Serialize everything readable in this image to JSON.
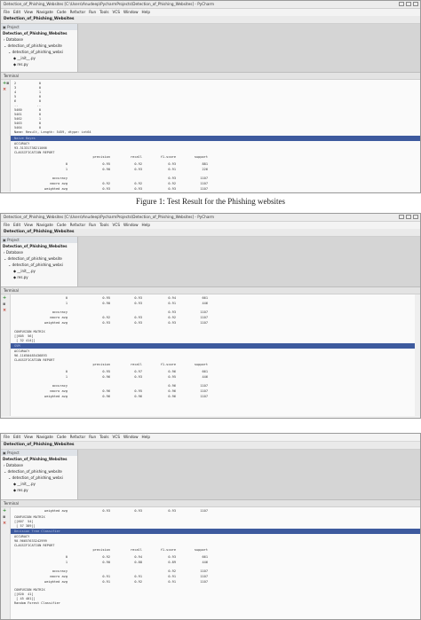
{
  "caption": "Figure 1: Test Result for the Phishing websites",
  "window_title": "Detection_of_Phishing_Websites [C:\\Users\\Anudeep\\PycharmProjects\\Detection_of_Phishing_Websites] - PyCharm",
  "menu": [
    "File",
    "Edit",
    "View",
    "Navigate",
    "Code",
    "Refactor",
    "Run",
    "Tools",
    "VCS",
    "Window",
    "Help"
  ],
  "breadcrumb": "Detection_of_Phishing_Websites",
  "project_tab": "Project",
  "tree": {
    "root": "Detection_of_Phishing_Websites",
    "items": [
      "Database",
      "detection_of_phishing_website",
      "detection_of_phishing_websi",
      "__init__.py",
      "res.py"
    ]
  },
  "terminal_label": "Terminal",
  "report_headers": {
    "precision": "precision",
    "recall": "recall",
    "f1": "f1-score",
    "support": "support"
  },
  "shot1": {
    "top_rows": [
      {
        "idx": "2",
        "val": "0"
      },
      {
        "idx": "3",
        "val": "0"
      },
      {
        "idx": "4",
        "val": "1"
      },
      {
        "idx": "5",
        "val": "0"
      },
      {
        "idx": "6",
        "val": "0"
      },
      {
        "idx": "..",
        "val": ".."
      },
      {
        "idx": "5460",
        "val": "0"
      },
      {
        "idx": "5461",
        "val": "0"
      },
      {
        "idx": "5462",
        "val": "1"
      },
      {
        "idx": "5463",
        "val": "0"
      },
      {
        "idx": "5464",
        "val": "0"
      }
    ],
    "series_info": "Name: Result, Length: 5459, dtype: int64",
    "highlight": "Naive Bayes",
    "accuracy_label": "ACCURACY",
    "accuracy_value": "93.31331738211066",
    "report_title": "CLASSIFICATION REPORT",
    "rows": [
      {
        "label": "0",
        "p": "0.95",
        "r": "0.92",
        "f": "0.93",
        "s": "881"
      },
      {
        "label": "1",
        "p": "0.90",
        "r": "0.93",
        "f": "0.91",
        "s": "226"
      },
      {
        "label": "accuracy",
        "p": "",
        "r": "",
        "f": "0.93",
        "s": "1107"
      },
      {
        "label": "macro avg",
        "p": "0.92",
        "r": "0.92",
        "f": "0.92",
        "s": "1107"
      },
      {
        "label": "weighted avg",
        "p": "0.93",
        "r": "0.93",
        "f": "0.93",
        "s": "1107"
      }
    ]
  },
  "shot2": {
    "top_rows": [
      {
        "label": "0",
        "p": "0.95",
        "r": "0.93",
        "f": "0.94",
        "s": "661"
      },
      {
        "label": "1",
        "p": "0.90",
        "r": "0.93",
        "f": "0.91",
        "s": "446"
      },
      {
        "label": "accuracy",
        "p": "",
        "r": "",
        "f": "0.93",
        "s": "1107"
      },
      {
        "label": "macro avg",
        "p": "0.92",
        "r": "0.93",
        "f": "0.92",
        "s": "1107"
      },
      {
        "label": "weighted avg",
        "p": "0.93",
        "r": "0.93",
        "f": "0.93",
        "s": "1107"
      }
    ],
    "matrix_title": "CONFUSION MATRIX",
    "matrix": [
      "[[605  56]",
      " [ 32 414]]"
    ],
    "highlight": "SVM",
    "accuracy_label": "ACCURACY",
    "accuracy_value": "96.11650485436893",
    "report_title": "CLASSIFICATION REPORT",
    "rows": [
      {
        "label": "0",
        "p": "0.95",
        "r": "0.97",
        "f": "0.96",
        "s": "661"
      },
      {
        "label": "1",
        "p": "0.96",
        "r": "0.93",
        "f": "0.95",
        "s": "446"
      },
      {
        "label": "accuracy",
        "p": "",
        "r": "",
        "f": "0.96",
        "s": "1107"
      },
      {
        "label": "macro avg",
        "p": "0.96",
        "r": "0.95",
        "f": "0.96",
        "s": "1107"
      },
      {
        "label": "weighted avg",
        "p": "0.96",
        "r": "0.96",
        "f": "0.96",
        "s": "1107"
      }
    ]
  },
  "shot3": {
    "first_line": {
      "label": "weighted avg",
      "p": "0.93",
      "r": "0.93",
      "f": "0.93",
      "s": "1107"
    },
    "matrix_title": "CONFUSION MATRIX",
    "matrix": [
      "[[607  54]",
      " [ 57 389]]"
    ],
    "highlight": "Decision Tree Classifier",
    "accuracy_label": "ACCURACY",
    "accuracy_value": "90.96657633242999",
    "report_title": "CLASSIFICATION REPORT",
    "rows": [
      {
        "label": "0",
        "p": "0.92",
        "r": "0.94",
        "f": "0.93",
        "s": "661"
      },
      {
        "label": "1",
        "p": "0.90",
        "r": "0.88",
        "f": "0.89",
        "s": "446"
      },
      {
        "label": "accuracy",
        "p": "",
        "r": "",
        "f": "0.92",
        "s": "1107"
      },
      {
        "label": "macro avg",
        "p": "0.91",
        "r": "0.91",
        "f": "0.91",
        "s": "1107"
      },
      {
        "label": "weighted avg",
        "p": "0.91",
        "r": "0.92",
        "f": "0.91",
        "s": "1107"
      }
    ],
    "matrix2_title": "CONFUSION MATRIX",
    "matrix2": [
      "[[620  41]",
      " [ 45 401]]"
    ],
    "footer": "Random Forest Classifier"
  },
  "colors": {
    "highlight": "#3d5a9e",
    "terminal_bg": "#fafafa",
    "editor_bg": "#d5d5d5"
  }
}
